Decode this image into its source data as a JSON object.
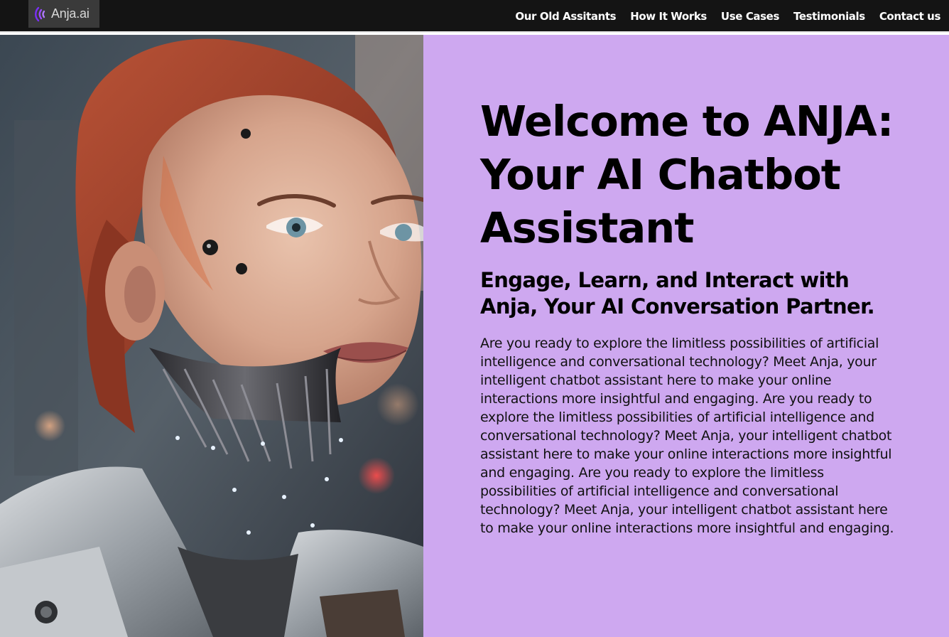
{
  "brand": {
    "name": "Anja.ai",
    "icon": "sound-wave-logo-icon",
    "accent": "#7b2ff7"
  },
  "nav": {
    "links": [
      {
        "label": "Our Old Assitants"
      },
      {
        "label": "How It Works"
      },
      {
        "label": "Use Cases"
      },
      {
        "label": "Testimonials"
      },
      {
        "label": "Contact us"
      }
    ]
  },
  "hero": {
    "image": "red-haired-android-woman-portrait",
    "panel_color": "#cea8f0",
    "headline": "Welcome to ANJA: Your AI Chatbot Assistant",
    "subheadline": "Engage, Learn, and Interact with Anja, Your AI Conversation Partner.",
    "body": "Are you ready to explore the limitless possibilities of artificial intelligence and conversational technology? Meet Anja, your intelligent chatbot assistant here to make your online interactions more insightful and engaging. Are you ready to explore the limitless possibilities of artificial intelligence and conversational technology? Meet Anja, your intelligent chatbot assistant here to make your online interactions more insightful and engaging. Are you ready to explore the limitless possibilities of artificial intelligence and conversational technology? Meet Anja, your intelligent chatbot assistant here to make your online interactions more insightful and engaging."
  }
}
